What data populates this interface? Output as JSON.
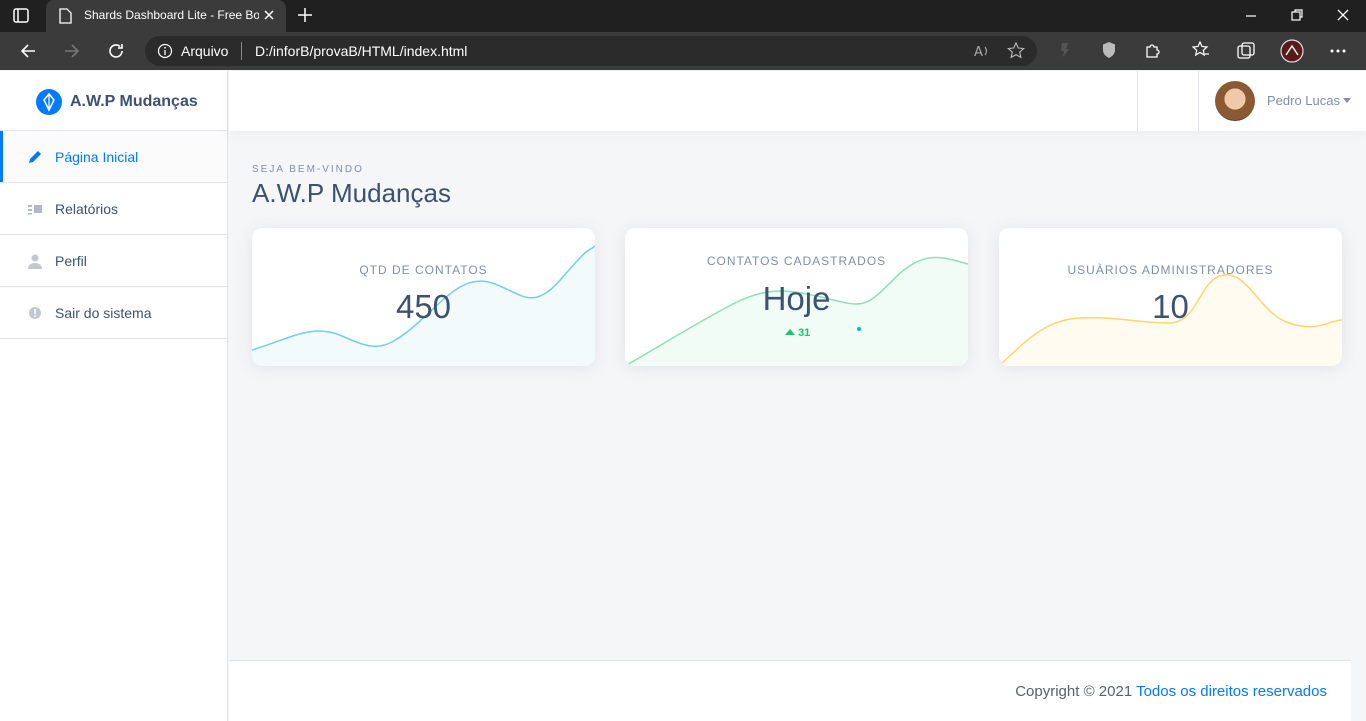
{
  "browser": {
    "tab_title": "Shards Dashboard Lite - Free Boo",
    "scheme_label": "Arquivo",
    "url": "D:/inforB/provaB/HTML/index.html"
  },
  "sidebar": {
    "brand": "A.W.P Mudanças",
    "items": [
      {
        "label": "Página Inicial",
        "icon": "pencil-icon",
        "active": true
      },
      {
        "label": "Relatórios",
        "icon": "list-icon",
        "active": false
      },
      {
        "label": "Perfil",
        "icon": "person-icon",
        "active": false
      },
      {
        "label": "Sair do sistema",
        "icon": "info-circle-icon",
        "active": false
      }
    ]
  },
  "topnav": {
    "user_name": "Pedro Lucas"
  },
  "header": {
    "subtitle": "SEJA BEM-VINDO",
    "title": "A.W.P Mudanças"
  },
  "cards": [
    {
      "label": "QTD DE CONTATOS",
      "value": "450",
      "color": "#5bc0de"
    },
    {
      "label": "CONTATOS CADASTRADOS",
      "value": "Hoje",
      "delta": "31",
      "color": "#17c671"
    },
    {
      "label": "USUÀRIOS ADMINISTRADORES",
      "value": "10",
      "color": "#ffb400"
    }
  ],
  "footer": {
    "copyright": "Copyright © 2021",
    "link": "Todos os direitos reservados"
  },
  "colors": {
    "accent": "#007bff",
    "text_dark": "#3d5170",
    "text_muted": "#818ea3"
  }
}
